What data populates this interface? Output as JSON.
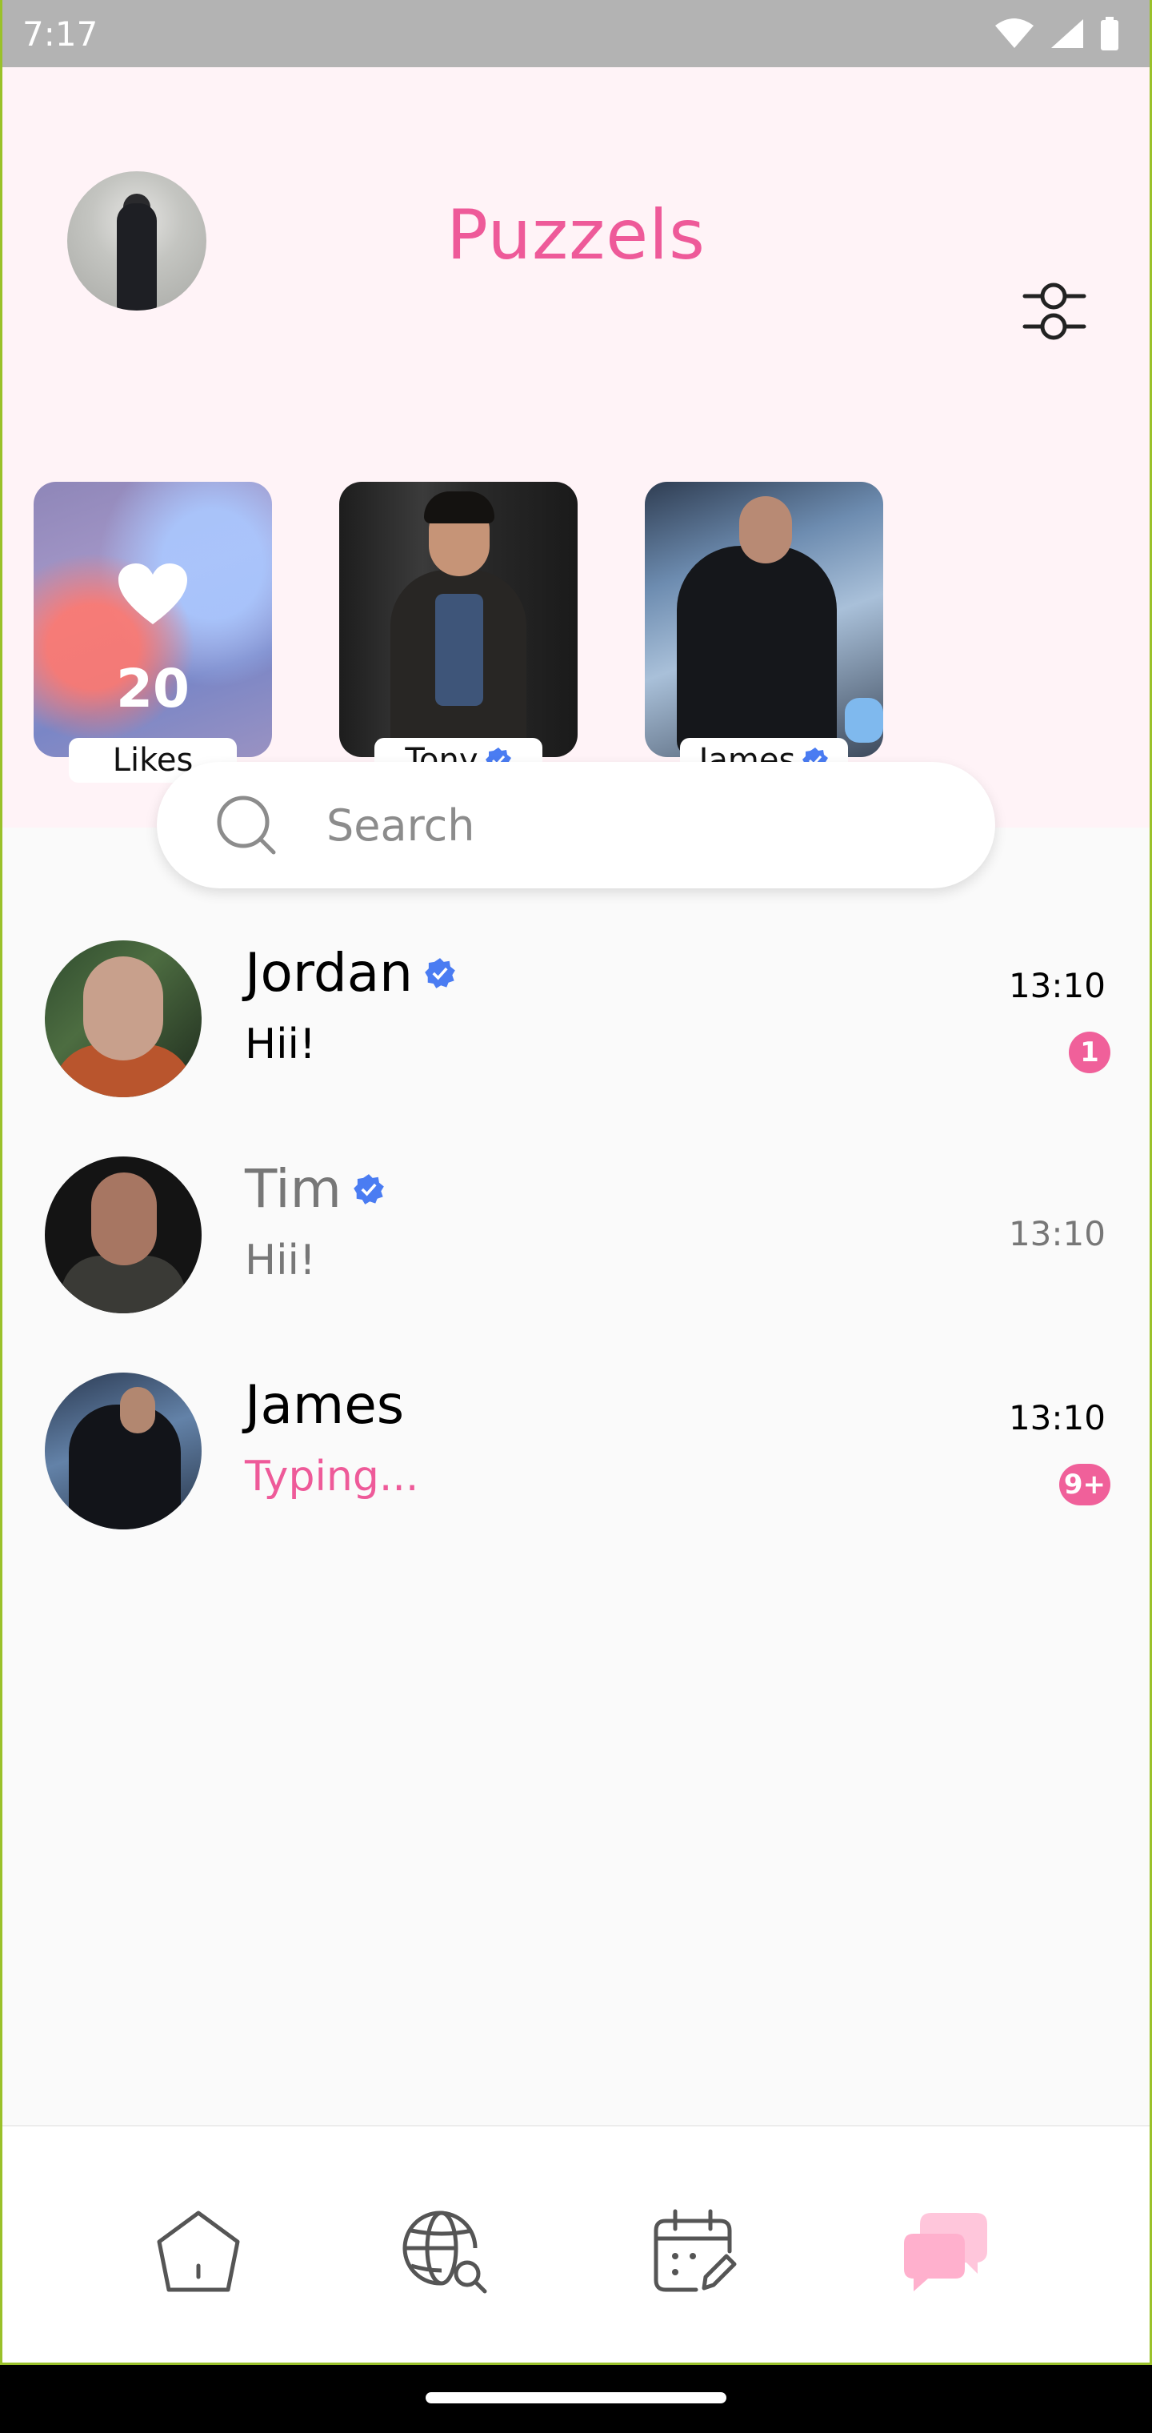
{
  "status_bar": {
    "time": "7:17"
  },
  "header": {
    "title": "Puzzels"
  },
  "stories": [
    {
      "label": "Likes",
      "count": "20",
      "verified": false
    },
    {
      "label": "Tony",
      "verified": true
    },
    {
      "label": "James",
      "verified": true
    }
  ],
  "search": {
    "placeholder": "Search"
  },
  "chats": [
    {
      "name": "Jordan",
      "verified": true,
      "message": "Hii!",
      "time": "13:10",
      "badge": "1",
      "read": false
    },
    {
      "name": "Tim",
      "verified": true,
      "message": "Hii!",
      "time": "13:10",
      "badge": "",
      "read": true
    },
    {
      "name": "James",
      "verified": false,
      "message": "Typing...",
      "time": "13:10",
      "badge": "9+",
      "read": false
    }
  ],
  "nav": [
    "home-icon",
    "globe-search-icon",
    "calendar-edit-icon",
    "chat-bubbles-icon"
  ],
  "colors": {
    "accent": "#ee5a99",
    "verified": "#4a7cf2",
    "hero_bg": "#fff3f7"
  }
}
